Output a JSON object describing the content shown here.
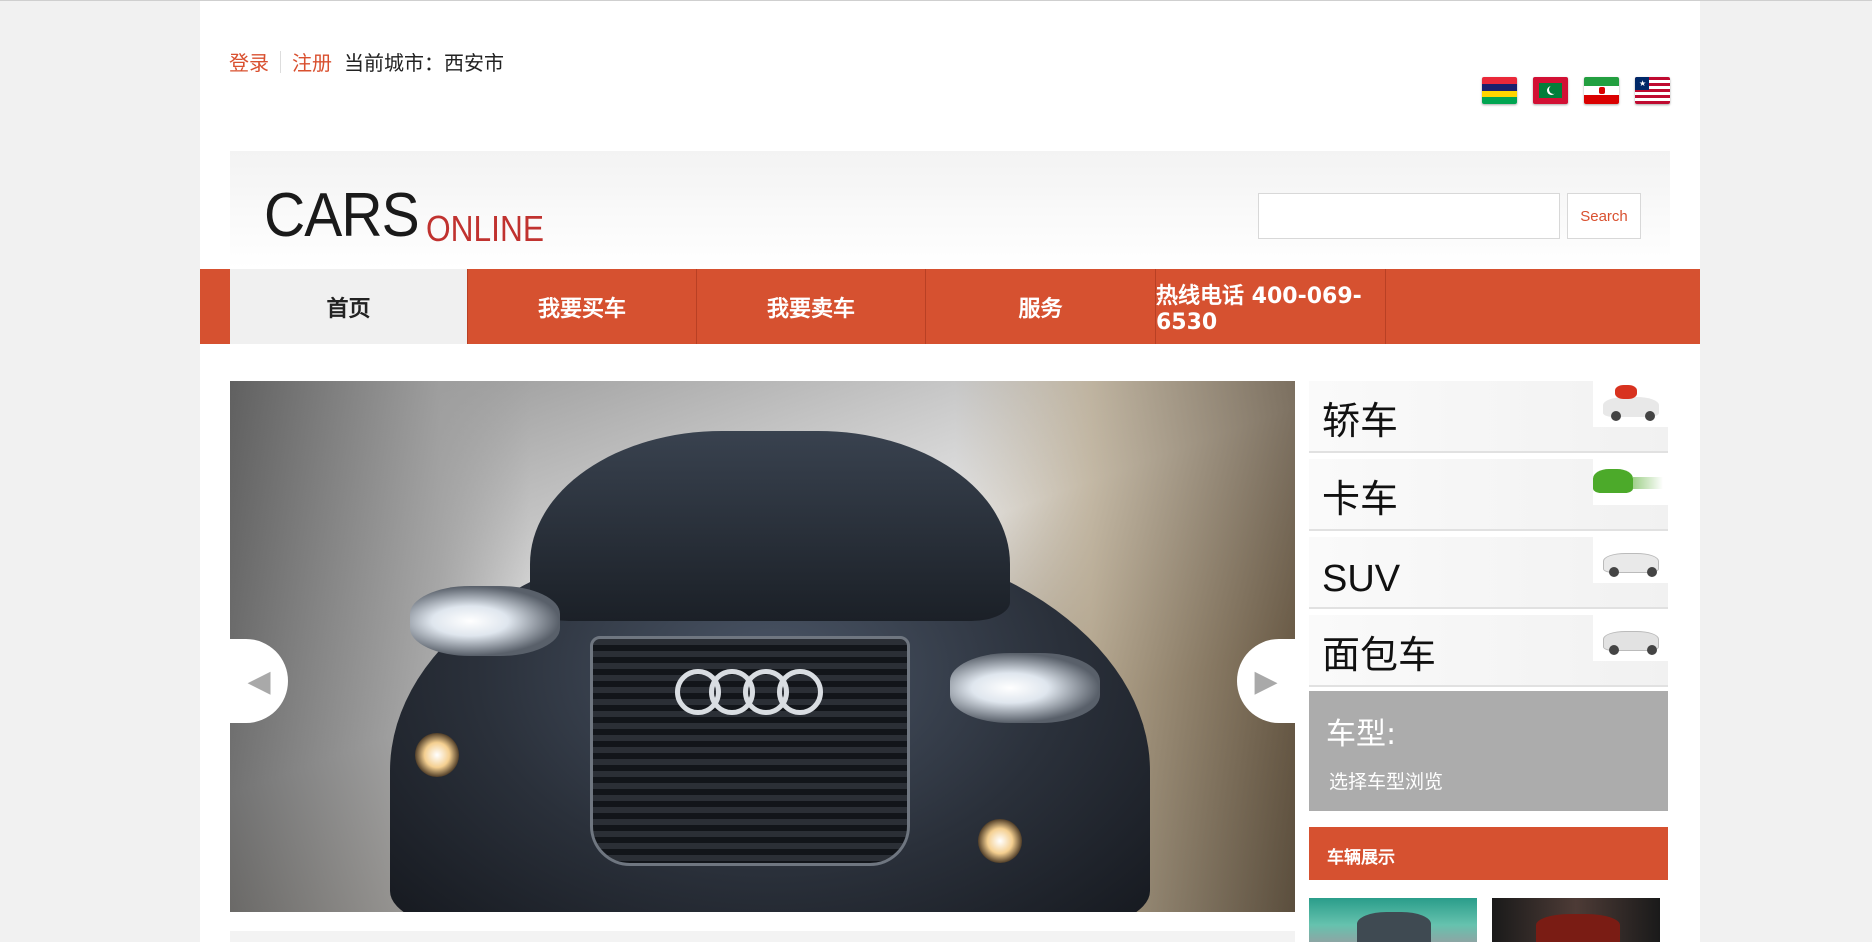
{
  "topbar": {
    "login": "登录",
    "register": "注册",
    "city": "当前城市：西安市"
  },
  "flags": [
    {
      "name": "mauritius-flag-icon",
      "colors": [
        "#EA2839",
        "#1A206D",
        "#FFD500",
        "#00A551"
      ]
    },
    {
      "name": "maldives-flag-icon",
      "colors": [
        "#D21034",
        "#007E3A",
        "#FFFFFF"
      ]
    },
    {
      "name": "iran-flag-icon",
      "colors": [
        "#239F40",
        "#FFFFFF",
        "#DA0000"
      ]
    },
    {
      "name": "liberia-flag-icon",
      "colors": [
        "#BF0A30",
        "#FFFFFF",
        "#002868"
      ]
    }
  ],
  "logo": {
    "main": "CARS",
    "sub": "ONLINE"
  },
  "search": {
    "value": "",
    "placeholder": "",
    "button": "Search"
  },
  "nav": {
    "items": [
      "首页",
      "我要买车",
      "我要卖车",
      "服务",
      "热线电话 400-069-6530"
    ],
    "active_index": 0
  },
  "slider": {
    "prev_icon": "chevron-left-icon",
    "next_icon": "chevron-right-icon"
  },
  "categories": [
    "轿车",
    "卡车",
    "SUV",
    "面包车"
  ],
  "car_type": {
    "title": "车型:",
    "desc": "选择车型浏览"
  },
  "showcase": {
    "title": "车辆展示"
  },
  "colors": {
    "accent": "#D65130",
    "panel_gray": "#ACACAC"
  }
}
